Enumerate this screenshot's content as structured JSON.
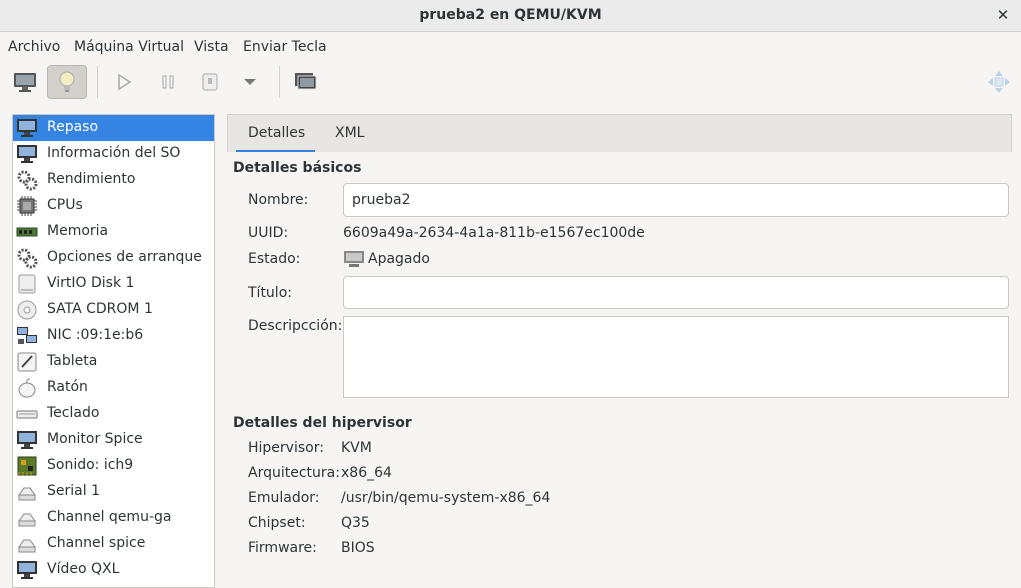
{
  "window": {
    "title": "prueba2 en QEMU/KVM"
  },
  "menu": [
    "Archivo",
    "Máquina Virtual",
    "Vista",
    "Enviar Tecla"
  ],
  "toolbar": {
    "buttons": [
      {
        "name": "console-view",
        "icon": "monitor-icon"
      },
      {
        "name": "details-view",
        "icon": "lightbulb-icon",
        "active": true
      },
      {
        "name": "run",
        "icon": "play-icon"
      },
      {
        "name": "pause",
        "icon": "pause-icon"
      },
      {
        "name": "shutdown",
        "icon": "power-icon"
      },
      {
        "name": "shutdown-menu",
        "icon": "chevron-down-icon"
      },
      {
        "name": "snapshots",
        "icon": "snapshot-icon"
      },
      {
        "name": "fullscreen",
        "icon": "fullscreen-icon"
      }
    ]
  },
  "sidebar": {
    "items": [
      {
        "label": "Repaso",
        "icon": "monitor-icon",
        "selected": true
      },
      {
        "label": "Información del SO",
        "icon": "monitor-icon"
      },
      {
        "label": "Rendimiento",
        "icon": "gears-icon"
      },
      {
        "label": "CPUs",
        "icon": "cpu-icon"
      },
      {
        "label": "Memoria",
        "icon": "memory-icon"
      },
      {
        "label": "Opciones de arranque",
        "icon": "gears-icon"
      },
      {
        "label": "VirtIO Disk 1",
        "icon": "disk-icon"
      },
      {
        "label": "SATA CDROM 1",
        "icon": "cdrom-icon"
      },
      {
        "label": "NIC :09:1e:b6",
        "icon": "network-icon"
      },
      {
        "label": "Tableta",
        "icon": "tablet-icon"
      },
      {
        "label": "Ratón",
        "icon": "mouse-icon"
      },
      {
        "label": "Teclado",
        "icon": "keyboard-icon"
      },
      {
        "label": "Monitor Spice",
        "icon": "monitor-icon"
      },
      {
        "label": "Sonido: ich9",
        "icon": "sound-card-icon"
      },
      {
        "label": "Serial 1",
        "icon": "serial-icon"
      },
      {
        "label": "Channel qemu-ga",
        "icon": "serial-icon"
      },
      {
        "label": "Channel spice",
        "icon": "serial-icon"
      },
      {
        "label": "Vídeo QXL",
        "icon": "monitor-icon"
      }
    ]
  },
  "tabs": [
    {
      "label": "Detalles",
      "active": true
    },
    {
      "label": "XML"
    }
  ],
  "basic": {
    "heading": "Detalles básicos",
    "name_label": "Nombre:",
    "name_value": "prueba2",
    "uuid_label": "UUID:",
    "uuid_value": "6609a49a-2634-4a1a-811b-e1567ec100de",
    "state_label": "Estado:",
    "state_value": "Apagado",
    "title_label": "Título:",
    "title_value": "",
    "desc_label": "Descripcción:",
    "desc_value": ""
  },
  "hypervisor": {
    "heading": "Detalles del hipervisor",
    "rows": [
      {
        "label": "Hipervisor:",
        "value": "KVM"
      },
      {
        "label": "Arquitectura:",
        "value": "x86_64"
      },
      {
        "label": "Emulador:",
        "value": "/usr/bin/qemu-system-x86_64"
      },
      {
        "label": "Chipset:",
        "value": "Q35"
      },
      {
        "label": "Firmware:",
        "value": "BIOS"
      }
    ]
  },
  "colors": {
    "accent": "#3584e4",
    "selected_text": "#ffffff"
  }
}
